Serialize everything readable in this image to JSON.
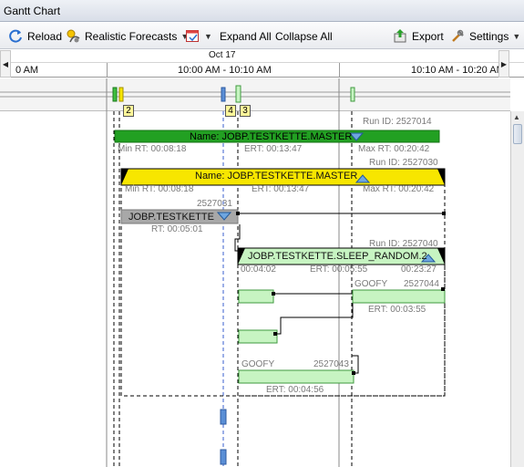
{
  "window": {
    "title": "Gantt Chart"
  },
  "toolbar": {
    "reload": "Reload",
    "forecast": "Realistic Forecasts",
    "expand_all": "Expand All",
    "collapse_all": "Collapse All",
    "export": "Export",
    "settings": "Settings"
  },
  "timeline": {
    "date": "Oct 17",
    "ticks": [
      "0 AM",
      "10:00 AM - 10:10 AM",
      "10:10 AM - 10:20 AM"
    ]
  },
  "markers": [
    "2",
    "4",
    "3"
  ],
  "rows": {
    "master1": {
      "name": "Name: JOBP.TESTKETTE.MASTER",
      "run_id": "Run ID: 2527014",
      "min_rt": "Min RT: 00:08:18",
      "ert": "ERT: 00:13:47",
      "max_rt": "Max RT: 00:20:42"
    },
    "master2": {
      "name": "Name: JOBP.TESTKETTE.MASTER",
      "run_id": "Run ID: 2527030",
      "min_rt": "Min RT: 00:08:18",
      "ert": "ERT: 00:13:47",
      "max_rt": "Max RT: 00:20:42"
    },
    "kette": {
      "id": "2527031",
      "name": "JOBP.TESTKETTE",
      "rt": "RT: 00:05:01"
    },
    "sleep": {
      "run_id": "Run ID: 2527040",
      "name": "JOBP.TESTKETTE.SLEEP_RANDOM.2",
      "start": "00:04:02",
      "ert": "ERT: 00:05:55",
      "end": "00:23:27"
    },
    "goofy1": {
      "name": "GOOFY",
      "id": "2527044",
      "ert": "ERT: 00:03:55"
    },
    "goofy2": {
      "name": "GOOFY",
      "id": "2527043",
      "ert": "ERT: 00:04:56"
    }
  },
  "colors": {
    "green": "#22a022",
    "yellow": "#f7e600",
    "gray": "#a8a8a8",
    "lightgreen": "#c7f4c2",
    "accent": "#3a6fc4"
  },
  "icons": {
    "reload": "reload-icon",
    "forecast": "forecast-icon",
    "calendar": "calendar-icon",
    "export": "export-icon",
    "settings": "settings-icon"
  }
}
